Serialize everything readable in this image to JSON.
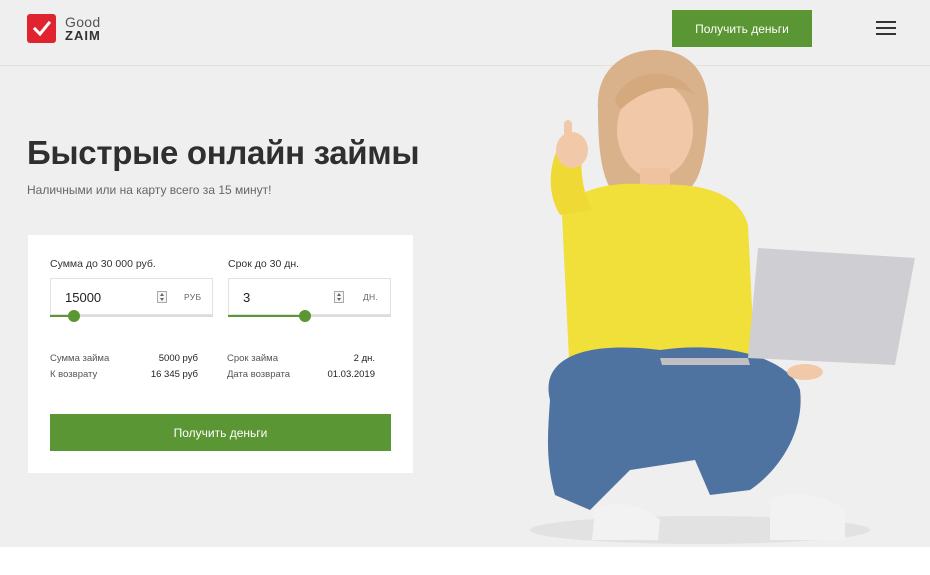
{
  "header": {
    "logo_good": "Good",
    "logo_zaim": "ZAIM",
    "cta_label": "Получить деньги"
  },
  "hero": {
    "title": "Быстрые онлайн займы",
    "subtitle": "Наличными или на карту всего за 15 минут!"
  },
  "calculator": {
    "amount": {
      "label": "Сумма до 30 000 руб.",
      "value": "15000",
      "unit": "РУБ",
      "slider_fraction": 0.15
    },
    "term": {
      "label": "Срок до 30 дн.",
      "value": "3",
      "unit": "ДН.",
      "slider_fraction": 0.47
    },
    "summary_left": [
      {
        "label": "Сумма займа",
        "value": "5000 руб"
      },
      {
        "label": "К возврату",
        "value": "16 345 руб"
      }
    ],
    "summary_right": [
      {
        "label": "Срок займа",
        "value": "2 дн."
      },
      {
        "label": "Дата возврата",
        "value": "01.03.2019"
      }
    ],
    "cta_label": "Получить деньги"
  },
  "colors": {
    "accent": "#5a9634",
    "logo_red": "#e0242f",
    "background": "#efefef"
  },
  "icons": {
    "menu": "hamburger-menu-icon",
    "logo": "checkmark-logo-icon"
  }
}
